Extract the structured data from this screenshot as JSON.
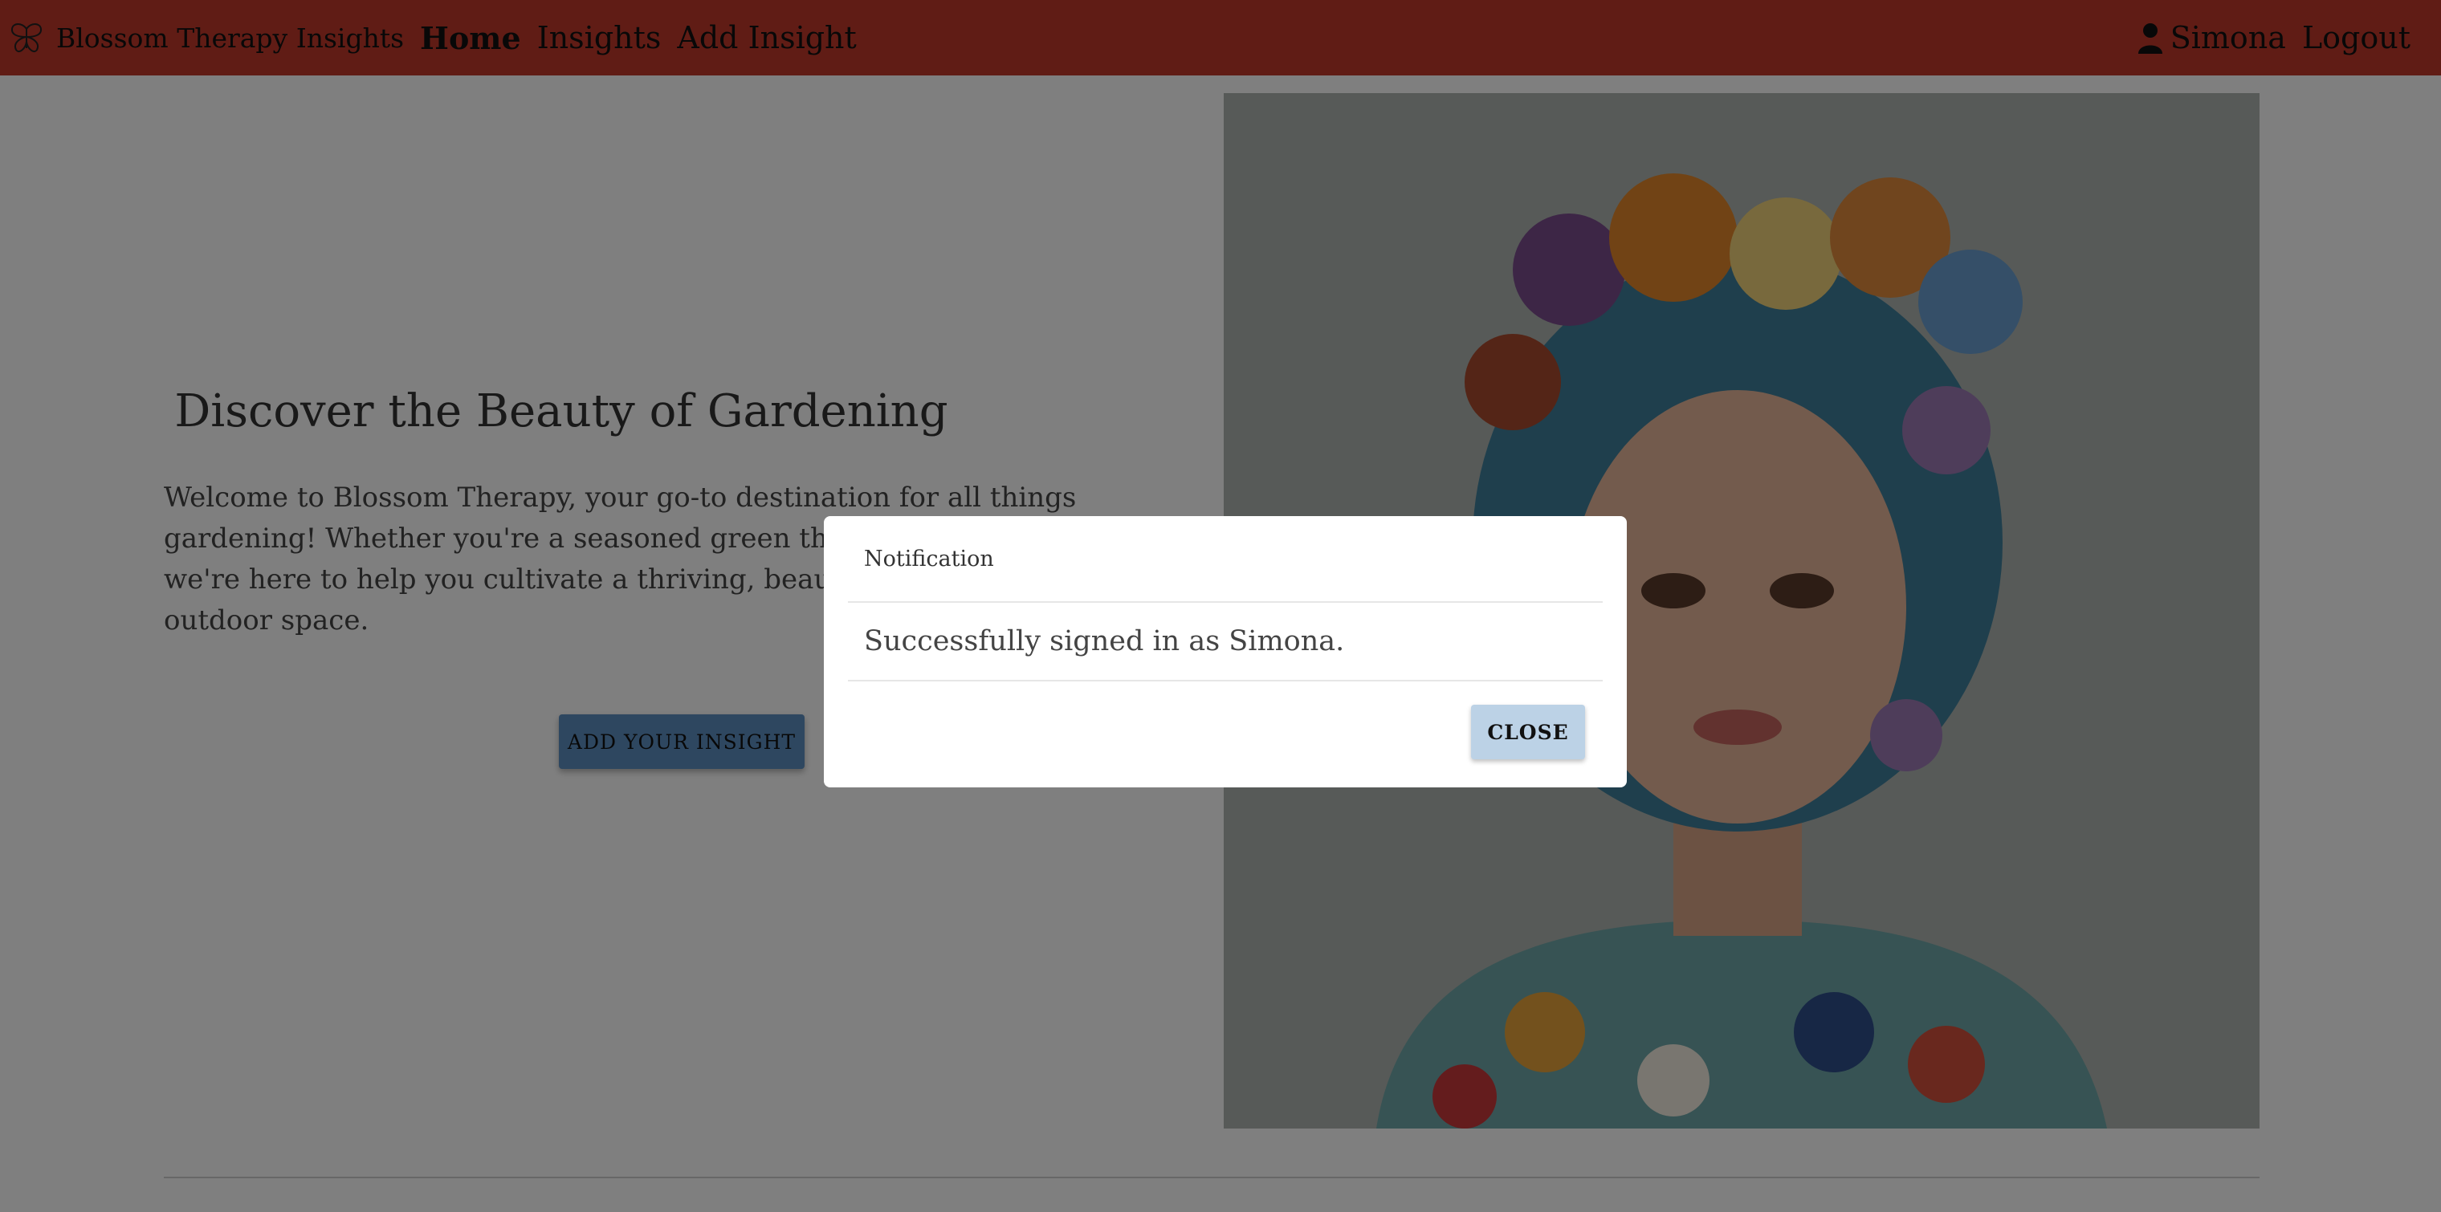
{
  "navbar": {
    "brand_name": "Blossom Therapy Insights",
    "links": [
      "Home",
      "Insights",
      "Add Insight"
    ],
    "user_name": "Simona",
    "logout_label": "Logout",
    "bg_color": "#c0392b"
  },
  "hero": {
    "title": "Discover the Beauty of Gardening",
    "text": "Welcome to Blossom Therapy, your go-to destination for all things gardening! Whether you're a seasoned green thumb or just starting out, we're here to help you cultivate a thriving, beautiful, and peaceful outdoor space.",
    "cta_label": "ADD YOUR INSIGHT",
    "image_description_icon": "flower-crown-portrait-image"
  },
  "modal": {
    "title": "Notification",
    "message": "Successfully signed in as Simona.",
    "close_label": "CLOSE"
  }
}
